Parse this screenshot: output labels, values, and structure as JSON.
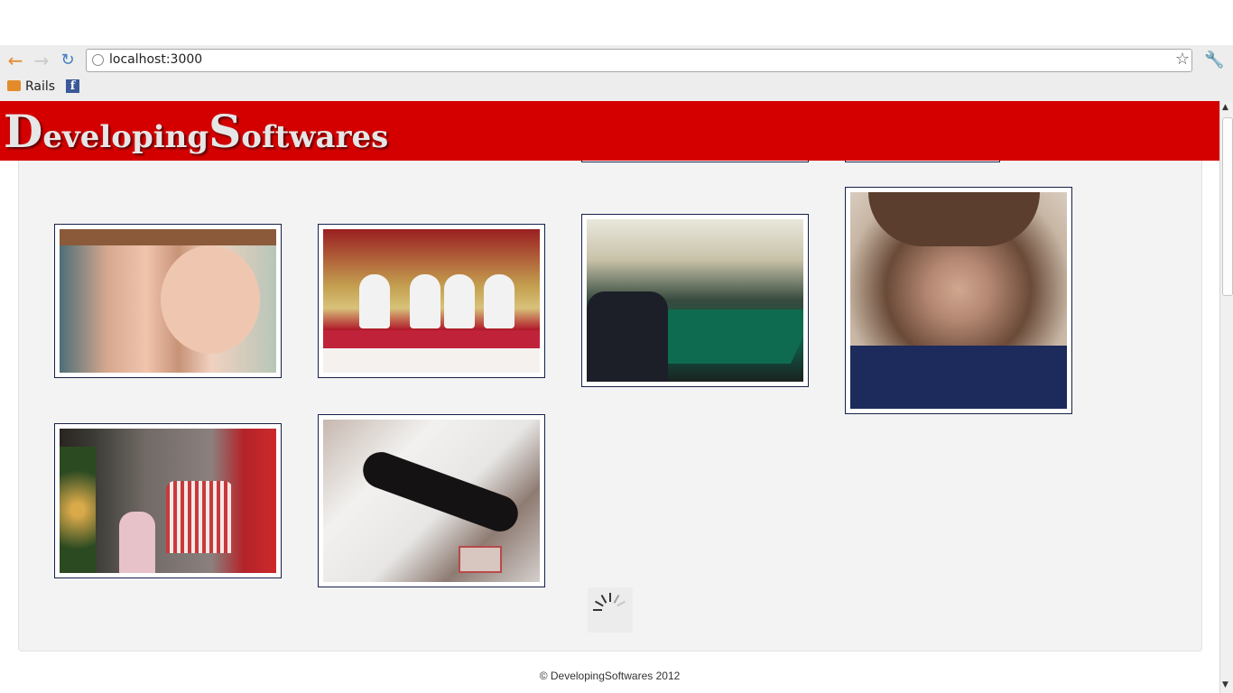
{
  "browser": {
    "url": "localhost:3000",
    "bookmarks": [
      {
        "label": "Rails",
        "icon": "folder-icon"
      },
      {
        "label": "",
        "icon": "facebook-icon"
      }
    ],
    "icons": {
      "back": "back-arrow-icon",
      "forward": "forward-arrow-icon",
      "reload": "reload-icon",
      "site": "globe-icon",
      "bookmark_star": "star-icon",
      "settings": "wrench-icon"
    }
  },
  "site": {
    "logo": {
      "first_cap": "D",
      "first_rest": "eveloping",
      "second_cap": "S",
      "second_rest": "oftwares"
    },
    "brand_color": "#d40000",
    "gallery": {
      "photos": [
        {
          "subject": "partially scrolled photo (top)",
          "column": 3
        },
        {
          "subject": "partially scrolled photo (top)",
          "column": 4
        },
        {
          "subject": "mother and baby",
          "column": 1
        },
        {
          "subject": "nuns at a table",
          "column": 2
        },
        {
          "subject": "conference room meeting",
          "column": 3
        },
        {
          "subject": "boy selfie",
          "column": 4
        },
        {
          "subject": "man reading with girl",
          "column": 1
        },
        {
          "subject": "girl holding phone",
          "column": 2
        }
      ],
      "loading": true
    },
    "footer": "© DevelopingSoftwares 2012"
  }
}
